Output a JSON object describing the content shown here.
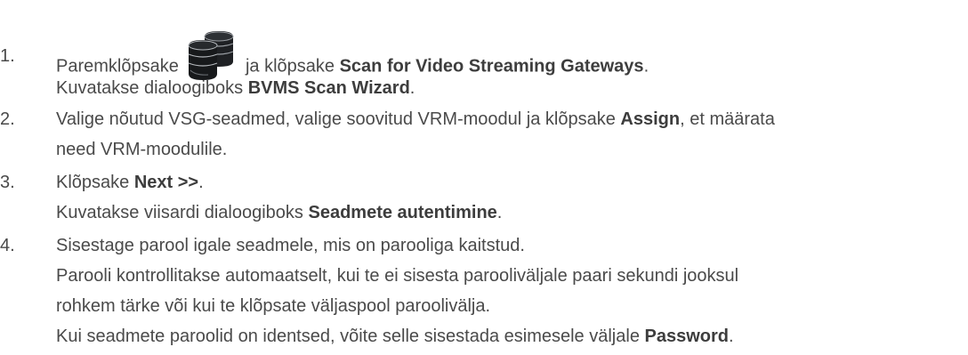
{
  "steps": [
    {
      "number": "1.",
      "lines": [
        {
          "pre": "Paremklõpsake ",
          "icon": "database-stack-icon",
          "mid": " ja klõpsake ",
          "bold": "Scan for Video Streaming Gateways",
          "post": "."
        },
        {
          "pre": "Kuvatakse dialoogiboks ",
          "bold": "BVMS Scan Wizard",
          "post": "."
        }
      ]
    },
    {
      "number": "2.",
      "lines": [
        {
          "pre": "Valige nõutud VSG-seadmed, valige soovitud VRM-moodul ja klõpsake ",
          "bold": "Assign",
          "post": ", et määrata"
        },
        {
          "pre": "need VRM-moodulile."
        }
      ]
    },
    {
      "number": "3.",
      "lines": [
        {
          "pre": "Klõpsake ",
          "bold": "Next >>",
          "post": "."
        },
        {
          "pre": "Kuvatakse viisardi dialoogiboks ",
          "bold": "Seadmete autentimine",
          "post": "."
        }
      ]
    },
    {
      "number": "4.",
      "lines": [
        {
          "pre": "Sisestage parool igale seadmele, mis on parooliga kaitstud."
        },
        {
          "pre": "Parooli kontrollitakse automaatselt, kui te ei sisesta parooliväljale paari sekundi jooksul"
        },
        {
          "pre": "rohkem tärke või kui te klõpsate väljaspool paroolivälja."
        },
        {
          "pre": "Kui seadmete paroolid on identsed, võite selle sisestada esimesele väljale ",
          "bold": "Password",
          "post": "."
        }
      ]
    }
  ]
}
